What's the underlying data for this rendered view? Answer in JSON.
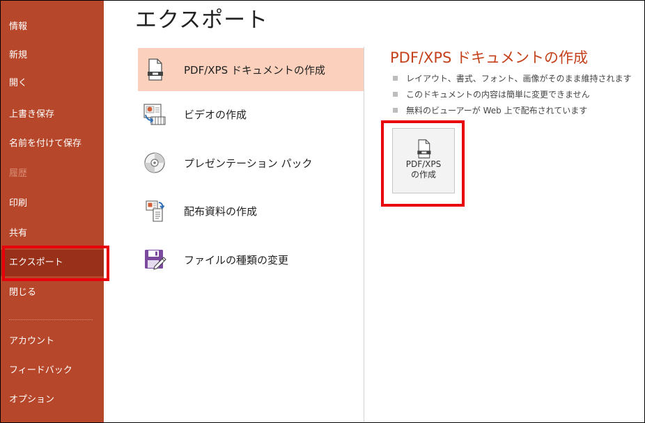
{
  "sidebar": {
    "items": [
      {
        "label": "情報",
        "state": "normal"
      },
      {
        "label": "新規",
        "state": "normal"
      },
      {
        "label": "開く",
        "state": "normal"
      },
      {
        "label": "上書き保存",
        "state": "normal"
      },
      {
        "label": "名前を付けて保存",
        "state": "normal"
      },
      {
        "label": "履歴",
        "state": "disabled"
      },
      {
        "label": "印刷",
        "state": "normal"
      },
      {
        "label": "共有",
        "state": "normal"
      },
      {
        "label": "エクスポート",
        "state": "selected"
      },
      {
        "label": "閉じる",
        "state": "normal"
      },
      {
        "label": "アカウント",
        "state": "normal"
      },
      {
        "label": "フィードバック",
        "state": "normal"
      },
      {
        "label": "オプション",
        "state": "normal"
      }
    ]
  },
  "main": {
    "title": "エクスポート",
    "options": [
      {
        "label": "PDF/XPS ドキュメントの作成",
        "icon": "pdf-document-icon",
        "selected": true
      },
      {
        "label": "ビデオの作成",
        "icon": "video-icon",
        "selected": false
      },
      {
        "label": "プレゼンテーション パック",
        "icon": "cd-package-icon",
        "selected": false
      },
      {
        "label": "配布資料の作成",
        "icon": "handouts-icon",
        "selected": false
      },
      {
        "label": "ファイルの種類の変更",
        "icon": "save-as-type-icon",
        "selected": false
      }
    ]
  },
  "detail": {
    "title": "PDF/XPS ドキュメントの作成",
    "bullets": [
      "レイアウト、書式、フォント、画像がそのまま維持されます",
      "このドキュメントの内容は簡単に変更できません",
      "無料のビューアーが Web 上で配布されています"
    ],
    "button": {
      "line1": "PDF/XPS",
      "line2": "の作成",
      "icon": "pdf-document-icon"
    }
  },
  "colors": {
    "accent": "#b7472a",
    "accent_dark": "#98301a",
    "selected_bg": "#fbd0bc",
    "highlight": "#e8000b",
    "title_accent": "#c4421b"
  }
}
